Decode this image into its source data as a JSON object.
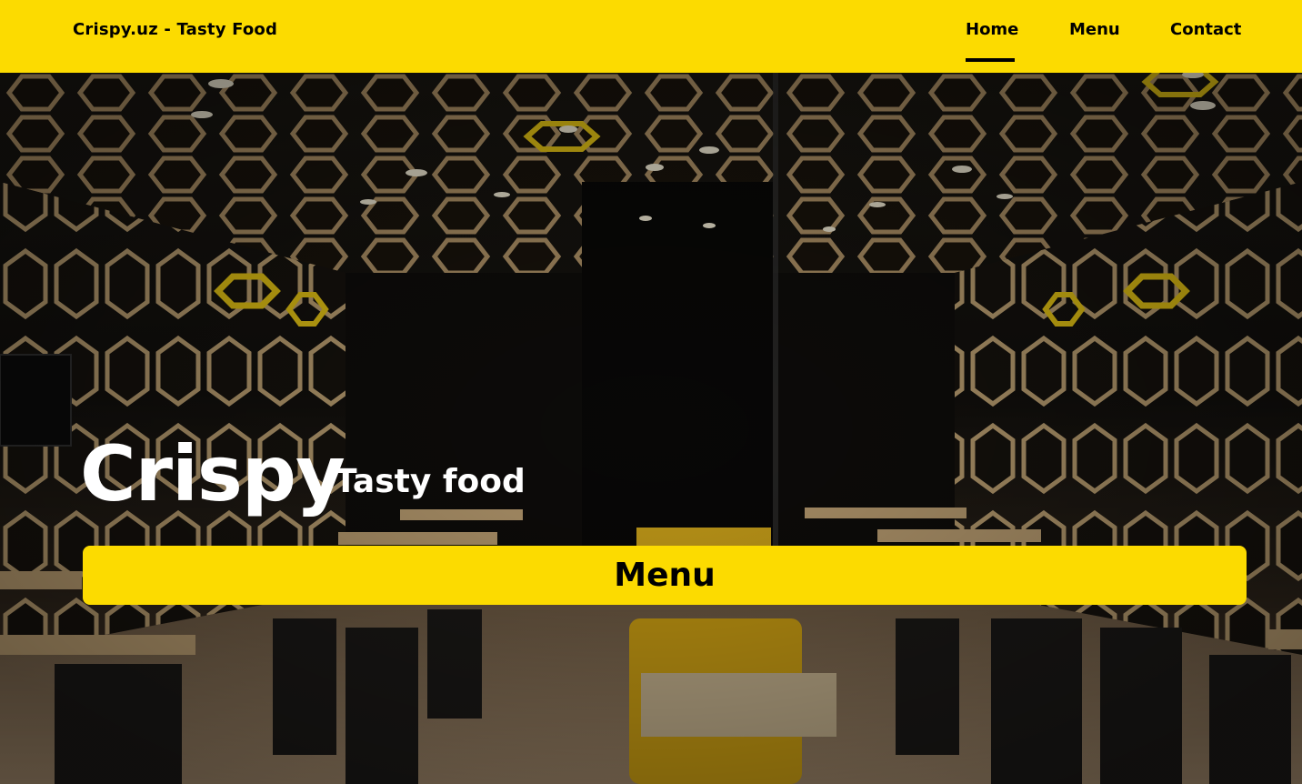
{
  "nav": {
    "brand": "Crispy.uz - Tasty Food",
    "links": [
      {
        "label": "Home",
        "active": true
      },
      {
        "label": "Menu",
        "active": false
      },
      {
        "label": "Contact",
        "active": false
      }
    ]
  },
  "hero": {
    "title": "Crispy",
    "subtitle": "Tasty food",
    "menu_button": "Menu",
    "background_image": "restaurant-interior-photo"
  },
  "colors": {
    "accent": "#fcdb00",
    "text_dark": "#000000",
    "text_light": "#ffffff"
  }
}
